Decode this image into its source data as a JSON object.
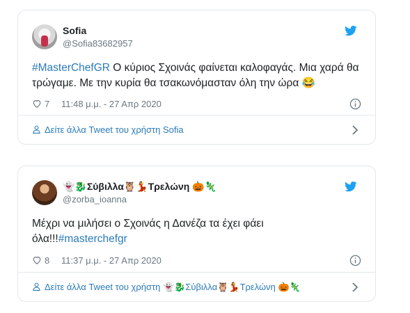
{
  "colors": {
    "link": "#2b7bb9",
    "muted": "#697882",
    "border": "#e1e8ed",
    "twitter_blue": "#1da1f2"
  },
  "tweets": [
    {
      "display_name": "Sofia",
      "handle": "@Sofia83682957",
      "text_hashtag": "#MasterChefGR",
      "text_body": " Ο κύριος Σχοινάς φαίνεται καλοφαγάς. Μια χαρά θα τρώγαμε. Με την κυρία θα τσακωνόμασταν όλη την ώρα 😂",
      "likes": "7",
      "timestamp": "11:48 μ.μ. - 27 Απρ 2020",
      "footer_label": "Δείτε άλλα Tweet του χρήστη Sofia",
      "icons": [
        "avatar",
        "twitter-bird-icon",
        "heart-icon",
        "info-icon",
        "person-icon",
        "chevron-right-icon"
      ]
    },
    {
      "display_name": "👻🐉Σύβιλλα🦉💃Τρελώνη 🎃🦎",
      "handle": "@zorba_ioanna",
      "text_body": "Μέχρι να μιλήσει ο Σχοινάς η Δανέζα τα έχει φάει όλα!!!",
      "text_hashtag": "#masterchefgr",
      "likes": "8",
      "timestamp": "11:37 μ.μ. - 27 Απρ 2020",
      "footer_label": "Δείτε άλλα Tweet του χρήστη 👻🐉Σύβιλλα🦉💃Τρελώνη 🎃🦎",
      "icons": [
        "avatar",
        "twitter-bird-icon",
        "heart-icon",
        "info-icon",
        "person-icon",
        "chevron-right-icon"
      ]
    }
  ]
}
